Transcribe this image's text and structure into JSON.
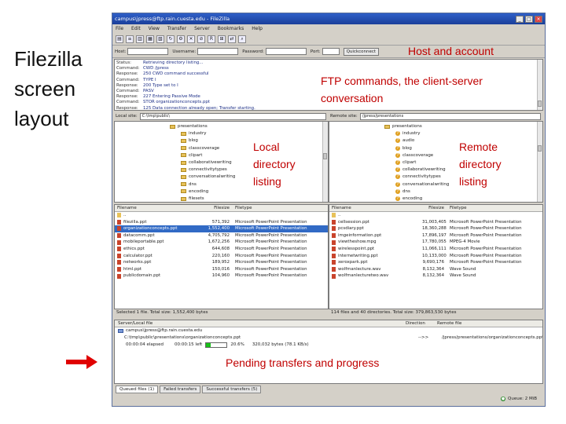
{
  "slide": {
    "title": "Filezilla screen layout"
  },
  "annotations": {
    "host": "Host and account",
    "ftp": "FTP commands, the client-server conversation",
    "local": "Local directory listing",
    "remote": "Remote directory listing",
    "pending": "Pending transfers and progress"
  },
  "window": {
    "title": "campus\\jpress@ftp.rain.cuesta.edu - FileZilla",
    "menu": [
      "File",
      "Edit",
      "View",
      "Transfer",
      "Server",
      "Bookmarks",
      "Help"
    ],
    "quickconnect": {
      "host_label": "Host:",
      "username_label": "Username:",
      "password_label": "Password:",
      "port_label": "Port:",
      "button": "Quickconnect"
    },
    "log": [
      {
        "k": "Status:",
        "m": "Retrieving directory listing..."
      },
      {
        "k": "Command:",
        "m": "CWD /jpress"
      },
      {
        "k": "Response:",
        "m": "250 CWD command successful"
      },
      {
        "k": "Command:",
        "m": "TYPE I"
      },
      {
        "k": "Response:",
        "m": "200 Type set to I"
      },
      {
        "k": "Command:",
        "m": "PASV"
      },
      {
        "k": "Response:",
        "m": "227 Entering Passive Mode"
      },
      {
        "k": "Command:",
        "m": "STOR organizationconcepts.ppt"
      },
      {
        "k": "Response:",
        "m": "125 Data connection already open; Transfer starting."
      }
    ],
    "local": {
      "label": "Local site:",
      "path": "C:\\tmp\\public\\",
      "tree": [
        "presentations",
        "industry",
        "blog",
        "classcoverage",
        "clipart",
        "collaborativewriting",
        "connectivitytypes",
        "conversationalwriting",
        "dns",
        "encoding",
        "filesets"
      ],
      "columns": [
        "Filename",
        "Filesize",
        "Filetype"
      ],
      "rows": [
        {
          "name": "..",
          "size": "",
          "type": "",
          "folder": true
        },
        {
          "name": "filezilla.ppt",
          "size": "571,392",
          "type": "Microsoft PowerPoint Presentation"
        },
        {
          "name": "organizationconcepts.ppt",
          "size": "1,552,400",
          "type": "Microsoft PowerPoint Presentation",
          "selected": true
        },
        {
          "name": "datacomm.ppt",
          "size": "4,705,792",
          "type": "Microsoft PowerPoint Presentation"
        },
        {
          "name": "mobileportable.ppt",
          "size": "1,672,256",
          "type": "Microsoft PowerPoint Presentation"
        },
        {
          "name": "ethics.ppt",
          "size": "644,608",
          "type": "Microsoft PowerPoint Presentation"
        },
        {
          "name": "calculator.ppt",
          "size": "220,160",
          "type": "Microsoft PowerPoint Presentation"
        },
        {
          "name": "networks.ppt",
          "size": "189,952",
          "type": "Microsoft PowerPoint Presentation"
        },
        {
          "name": "html.ppt",
          "size": "150,016",
          "type": "Microsoft PowerPoint Presentation"
        },
        {
          "name": "publicdomain.ppt",
          "size": "104,960",
          "type": "Microsoft PowerPoint Presentation"
        }
      ],
      "status": "Selected 1 file. Total size: 1,552,400 bytes"
    },
    "remote": {
      "label": "Remote site:",
      "path": "/jpress/presentations",
      "tree": [
        "presentations",
        "industry",
        "audio",
        "blog",
        "classcoverage",
        "clipart",
        "collaborativewriting",
        "connectivitytypes",
        "conversationalwriting",
        "dns",
        "encoding"
      ],
      "columns": [
        "Filename",
        "Filesize",
        "Filetype"
      ],
      "rows": [
        {
          "name": "..",
          "size": "",
          "type": "",
          "folder": true
        },
        {
          "name": "cellsession.ppt",
          "size": "31,003,405",
          "type": "Microsoft PowerPoint Presentation"
        },
        {
          "name": "pcsdiary.ppt",
          "size": "18,360,288",
          "type": "Microsoft PowerPoint Presentation"
        },
        {
          "name": "imgeinformation.ppt",
          "size": "17,896,197",
          "type": "Microsoft PowerPoint Presentation"
        },
        {
          "name": "viewtheshow.mpg",
          "size": "17,780,055",
          "type": "MPEG-4 Movie"
        },
        {
          "name": "wirelesspoint.ppt",
          "size": "11,066,111",
          "type": "Microsoft PowerPoint Presentation"
        },
        {
          "name": "internetwriting.ppt",
          "size": "10,133,000",
          "type": "Microsoft PowerPoint Presentation"
        },
        {
          "name": "xeroxpark.ppt",
          "size": "9,690,176",
          "type": "Microsoft PowerPoint Presentation"
        },
        {
          "name": "wolfmanlecture.wav",
          "size": "8,132,364",
          "type": "Wave Sound"
        },
        {
          "name": "wolfmanlecturetwo.wav",
          "size": "8,132,364",
          "type": "Wave Sound"
        }
      ],
      "status": "114 files and 40 directories. Total size: 379,863,530 bytes"
    },
    "queue": {
      "columns": [
        "Server/Local file",
        "Direction",
        "Remote file"
      ],
      "server": "campus\\jpress@ftp.rain.cuesta.edu",
      "local_file": "C:\\tmp\\public\\presentations\\organizationconcepts.ppt",
      "direction": "-->>",
      "remote_file": "/jpress/presentations/organizationconcepts.ppt",
      "elapsed": "00:00:04 elapsed",
      "left": "00:00:15 left",
      "percent_label": "20.6%",
      "progress": 0.206,
      "bytes": "320,032 bytes (78.1 KB/s)",
      "tabs": [
        "Queued files (1)",
        "Failed transfers",
        "Successful transfers (5)"
      ],
      "status_queue": "Queue: 2 MiB"
    }
  }
}
